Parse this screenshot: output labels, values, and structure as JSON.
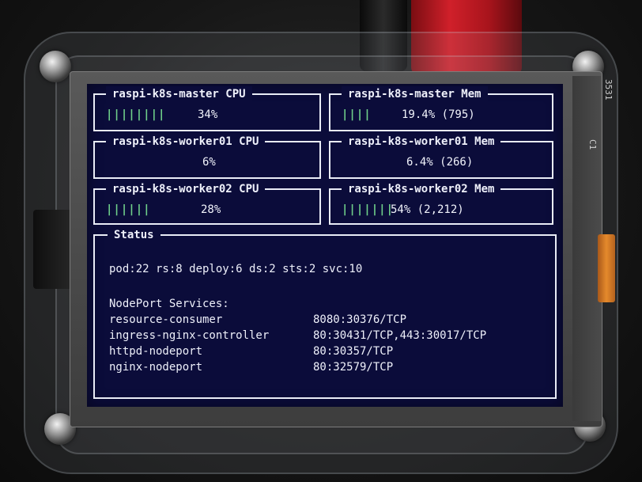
{
  "panels": [
    {
      "title": "raspi-k8s-master CPU",
      "bar": "||||||||",
      "value": "34%"
    },
    {
      "title": "raspi-k8s-master Mem",
      "bar": "||||",
      "value": "19.4% (795)"
    },
    {
      "title": "raspi-k8s-worker01 CPU",
      "bar": "",
      "value": "6%"
    },
    {
      "title": "raspi-k8s-worker01 Mem",
      "bar": "",
      "value": "6.4% (266)"
    },
    {
      "title": "raspi-k8s-worker02 CPU",
      "bar": "||||||",
      "value": "28%"
    },
    {
      "title": "raspi-k8s-worker02 Mem",
      "bar": "|||||||",
      "value": "54% (2,212)"
    }
  ],
  "status": {
    "title": "Status",
    "summary": "pod:22 rs:8 deploy:6 ds:2 sts:2 svc:10",
    "nodeport_heading": "NodePort Services:",
    "services": [
      {
        "name": "resource-consumer",
        "ports": "8080:30376/TCP"
      },
      {
        "name": "ingress-nginx-controller",
        "ports": "80:30431/TCP,443:30017/TCP"
      },
      {
        "name": "httpd-nodeport",
        "ports": "80:30357/TCP"
      },
      {
        "name": "nginx-nodeport",
        "ports": "80:32579/TCP"
      }
    ]
  },
  "board": {
    "label_top": "3531",
    "label_mid": "C1"
  },
  "colors": {
    "screen_bg": "#0b0c3a",
    "bar_green": "#6fd08a",
    "text": "#eef0fa"
  }
}
